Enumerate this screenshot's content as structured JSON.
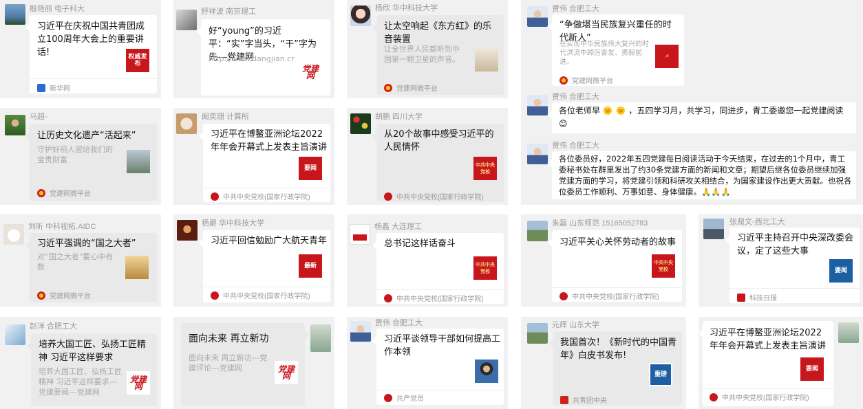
{
  "tiles": {
    "t1": {
      "name": "殷艳丽  电子科大",
      "title": "习近平在庆祝中国共青团成立100周年大会上的重要讲话!",
      "thumb": "权威发布",
      "source": "新华网"
    },
    "t2": {
      "name": "舒祥波 南京理工",
      "title": "好“young”的习近平：“实”字当头，“干”字为先---党建网",
      "link": "http://www.dangjian.cn/shouye/sixianglilun/xuexiyuandi/202205/t202...",
      "thumb": "党建网"
    },
    "t3": {
      "name": "杨欣 华中科技大学",
      "title": "让太空响起《东方红》的乐音装置",
      "desc": "让全世界人民都听到中国第一颗卫星的声音。",
      "source": "党建网微平台"
    },
    "t4": {
      "name": "贾伟  合肥工大",
      "title": "“争做堪当民族复兴重任的时代新人”",
      "desc": "在实现中华民族伟大复兴的时代洪流中踔厉奋发、勇毅前进。",
      "source": "党建网微平台"
    },
    "t5": {
      "name": "马超-",
      "title": "让历史文化遗产“活起来”",
      "desc": "守护好前人留给我们的宝贵财富",
      "source": "党建网微平台"
    },
    "t6": {
      "name": "阚奕珊 计算所",
      "title": "习近平在博鳌亚洲论坛2022年年会开幕式上发表主旨演讲",
      "thumb": "要闻",
      "source": "中共中央党校(国家行政学院)"
    },
    "t7": {
      "name": "胡鹏 四川大学",
      "title": "从20个故事中感受习近平的人民情怀",
      "thumb": "中共中央党校",
      "source": "中共中央党校(国家行政学院)"
    },
    "t8a": {
      "name": "贾伟  合肥工大",
      "text": "各位老师早 🌞 🌞 ，五四学习月，共学习，同进步，青工委邀您一起党建阅读 😊"
    },
    "t8b": {
      "name": "贾伟  合肥工大",
      "text": "各位委员好，2022年五四党建每日阅读活动于今天结束，在过去的1个月中，青工委秘书处在群里发出了约30条党建方面的新闻和文章；期望后继各位委员继续加强党建方面的学习，将党建引领和科研攻关相结合，为国家建设作出更大贡献。也祝各位委员工作顺利、万事如意、身体健康。🙏🙏🙏"
    },
    "t9": {
      "name": "刘昕 中科视拓.AIDC",
      "title": "习近平强调的“国之大者”",
      "desc": "对“国之大者”要心中有数",
      "source": "党建网微平台"
    },
    "t10": {
      "name": "杨爵 华中科技大学",
      "title": "习近平回信勉励广大航天青年",
      "thumb": "最新",
      "source": "中共中央党校(国家行政学院)"
    },
    "t11": {
      "name": "杨鑫 大连理工",
      "title": "总书记这样话奋斗",
      "thumb": "中共中央党校",
      "source": "中共中央党校(国家行政学院)"
    },
    "t12": {
      "name": "朱磊 山东师范 15165052783",
      "title": "习近平关心关怀劳动者的故事",
      "thumb": "中共中央党校",
      "source": "中共中央党校(国家行政学院)"
    },
    "t13": {
      "name": "张鼎文-西北工大",
      "title": "习近平主持召开中央深改委会议，定了这些大事",
      "thumb": "要闻",
      "source": "科技日报"
    },
    "t14": {
      "name": "赵洋 合肥工大",
      "title": "培养大国工匠、弘扬工匠精神 习近平这样要求",
      "desc": "培养大国工匠、弘扬工匠精神 习近平这样要求---党建要闻---党建网",
      "thumb": "党建网"
    },
    "t15": {
      "title": "面向未来 再立新功",
      "desc": "面向未来 再立新功---党建评论---党建网",
      "thumb": "党建网"
    },
    "t16": {
      "name": "贾伟  合肥工大",
      "title": "习近平谈领导干部如何提高工作本领",
      "source": "共产党员"
    },
    "t17": {
      "name": "元辉  山东大学",
      "title": "我国首次！《新时代的中国青年》白皮书发布!",
      "thumb": "重磅",
      "source": "共青团中央"
    },
    "t18": {
      "title": "习近平在博鳌亚洲论坛2022年年会开幕式上发表主旨演讲",
      "thumb": "要闻",
      "source": "中共中央党校(国家行政学院)"
    }
  },
  "colors": {
    "party_red": "#c8161d",
    "tile_bg": "#f1f1f1",
    "muted": "#9a9a9a"
  }
}
